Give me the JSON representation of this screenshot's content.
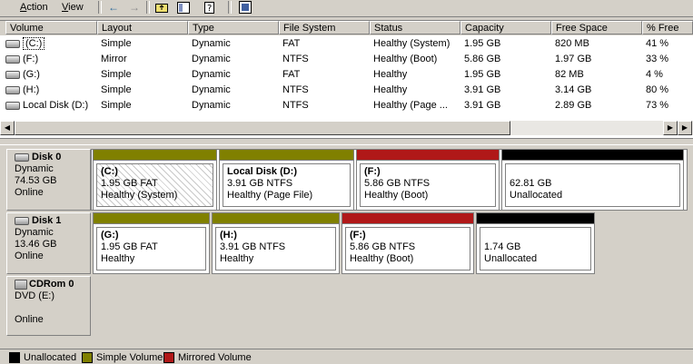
{
  "menu": {
    "action": "Action",
    "action_u": "A",
    "action_rest": "ction",
    "view": "View",
    "view_u": "V",
    "view_rest": "iew"
  },
  "toolbar": {
    "back_icon": "back-arrow-icon",
    "forward_icon": "forward-arrow-icon",
    "up_icon": "up-folder-icon",
    "properties_icon": "properties-icon",
    "help_icon": "help-icon",
    "settings_icon": "console-icon"
  },
  "columns": [
    "Volume",
    "Layout",
    "Type",
    "File System",
    "Status",
    "Capacity",
    "Free Space",
    "% Free"
  ],
  "volumes": [
    {
      "volume": "(C:)",
      "layout": "Simple",
      "type": "Dynamic",
      "fs": "FAT",
      "status": "Healthy (System)",
      "capacity": "1.95 GB",
      "free": "820 MB",
      "pct": "41 %"
    },
    {
      "volume": "(F:)",
      "layout": "Mirror",
      "type": "Dynamic",
      "fs": "NTFS",
      "status": "Healthy (Boot)",
      "capacity": "5.86 GB",
      "free": "1.97 GB",
      "pct": "33 %"
    },
    {
      "volume": "(G:)",
      "layout": "Simple",
      "type": "Dynamic",
      "fs": "FAT",
      "status": "Healthy",
      "capacity": "1.95 GB",
      "free": "82 MB",
      "pct": "4 %"
    },
    {
      "volume": "(H:)",
      "layout": "Simple",
      "type": "Dynamic",
      "fs": "NTFS",
      "status": "Healthy",
      "capacity": "3.91 GB",
      "free": "3.14 GB",
      "pct": "80 %"
    },
    {
      "volume": "Local Disk (D:)",
      "layout": "Simple",
      "type": "Dynamic",
      "fs": "NTFS",
      "status": "Healthy (Page ...",
      "capacity": "3.91 GB",
      "free": "2.89 GB",
      "pct": "73 %"
    }
  ],
  "disks": [
    {
      "name": "Disk 0",
      "type": "Dynamic",
      "size": "74.53 GB",
      "state": "Online",
      "partitions": [
        {
          "name": "(C:)",
          "size_fs": "1.95 GB FAT",
          "status": "Healthy (System)",
          "kind": "simple",
          "hatched": true
        },
        {
          "name": "Local Disk  (D:)",
          "size_fs": "3.91 GB NTFS",
          "status": "Healthy (Page File)",
          "kind": "simple"
        },
        {
          "name": "(F:)",
          "size_fs": "5.86 GB NTFS",
          "status": "Healthy (Boot)",
          "kind": "mirror"
        },
        {
          "name": "",
          "size_fs": "62.81 GB",
          "status": "Unallocated",
          "kind": "unallocated"
        }
      ]
    },
    {
      "name": "Disk 1",
      "type": "Dynamic",
      "size": "13.46 GB",
      "state": "Online",
      "partitions": [
        {
          "name": "(G:)",
          "size_fs": "1.95 GB FAT",
          "status": "Healthy",
          "kind": "simple"
        },
        {
          "name": "(H:)",
          "size_fs": "3.91 GB NTFS",
          "status": "Healthy",
          "kind": "simple"
        },
        {
          "name": "(F:)",
          "size_fs": "5.86 GB NTFS",
          "status": "Healthy (Boot)",
          "kind": "mirror"
        },
        {
          "name": "",
          "size_fs": "1.74 GB",
          "status": "Unallocated",
          "kind": "unallocated"
        }
      ]
    },
    {
      "name": "CDRom 0",
      "type": "DVD (E:)",
      "size": "",
      "state": "Online",
      "partitions": []
    }
  ],
  "legend": [
    {
      "label": "Unallocated",
      "color": "#000000"
    },
    {
      "label": "Simple Volume",
      "color": "#808000"
    },
    {
      "label": "Mirrored Volume",
      "color": "#b01818"
    }
  ],
  "colors": {
    "simple": "#808000",
    "mirror": "#b01818",
    "unallocated": "#000000"
  }
}
